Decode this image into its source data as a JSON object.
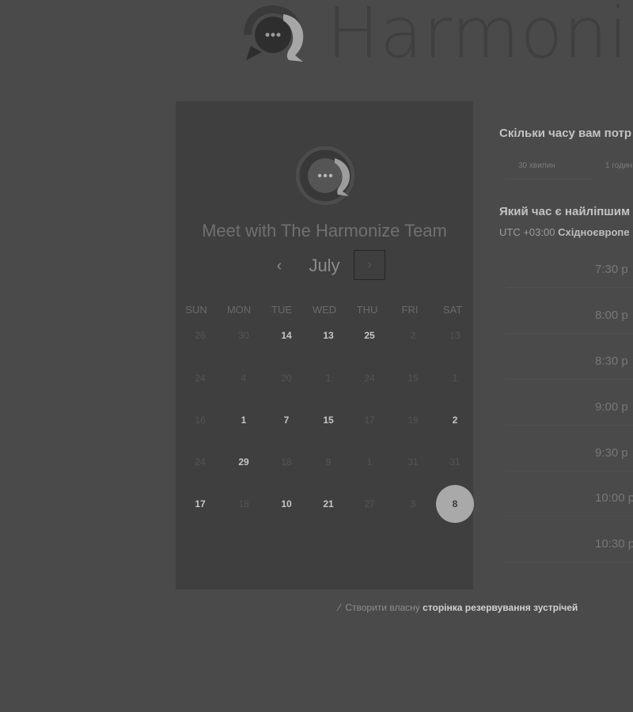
{
  "brand": {
    "name": "Harmoni"
  },
  "calendar": {
    "title": "Meet with The Harmonize Team",
    "month": "July",
    "prev_icon": "‹",
    "next_icon": "›",
    "weekdays": [
      "SUN",
      "MON",
      "TUE",
      "WED",
      "THU",
      "FRI",
      "SAT"
    ],
    "weeks": [
      [
        {
          "d": "26",
          "s": "muted"
        },
        {
          "d": "30",
          "s": "muted"
        },
        {
          "d": "14",
          "s": "avail"
        },
        {
          "d": "13",
          "s": "avail"
        },
        {
          "d": "25",
          "s": "avail"
        },
        {
          "d": "2",
          "s": "muted"
        },
        {
          "d": "13",
          "s": "muted"
        }
      ],
      [
        {
          "d": "24",
          "s": "muted"
        },
        {
          "d": "4",
          "s": "muted"
        },
        {
          "d": "20",
          "s": "muted"
        },
        {
          "d": "1",
          "s": "muted"
        },
        {
          "d": "24",
          "s": "muted"
        },
        {
          "d": "15",
          "s": "muted"
        },
        {
          "d": "1",
          "s": "muted"
        }
      ],
      [
        {
          "d": "16",
          "s": "muted"
        },
        {
          "d": "1",
          "s": "avail"
        },
        {
          "d": "7",
          "s": "avail"
        },
        {
          "d": "15",
          "s": "avail"
        },
        {
          "d": "17",
          "s": "muted"
        },
        {
          "d": "19",
          "s": "muted"
        },
        {
          "d": "2",
          "s": "avail"
        }
      ],
      [
        {
          "d": "24",
          "s": "muted"
        },
        {
          "d": "29",
          "s": "avail"
        },
        {
          "d": "18",
          "s": "muted"
        },
        {
          "d": "9",
          "s": "muted"
        },
        {
          "d": "1",
          "s": "muted"
        },
        {
          "d": "31",
          "s": "muted"
        },
        {
          "d": "31",
          "s": "muted"
        }
      ],
      [
        {
          "d": "17",
          "s": "avail"
        },
        {
          "d": "18",
          "s": "muted"
        },
        {
          "d": "10",
          "s": "avail"
        },
        {
          "d": "21",
          "s": "avail"
        },
        {
          "d": "27",
          "s": "muted"
        },
        {
          "d": "3",
          "s": "muted"
        },
        {
          "d": "8",
          "s": "selected"
        }
      ]
    ]
  },
  "duration": {
    "question": "Скільки часу вам потр",
    "options": [
      "30 хвилин",
      "1 годин"
    ],
    "selected_index": 0
  },
  "time": {
    "question": "Який час є найліпшим",
    "tz_prefix": "UTC +03:00",
    "tz_name": "Східноєвропе",
    "slots": [
      "7:30 p",
      "8:00 p",
      "8:30 p",
      "9:00 p",
      "9:30 p",
      "10:00 p",
      "10:30 p"
    ]
  },
  "footer": {
    "icon": "magic-wand-icon",
    "text": "Створити власну",
    "link": "сторінка резервування зустрічей"
  },
  "colors": {
    "background": "#4a4a4a",
    "card": "#3f3f3f",
    "selected_day": "#a9a9a9"
  }
}
